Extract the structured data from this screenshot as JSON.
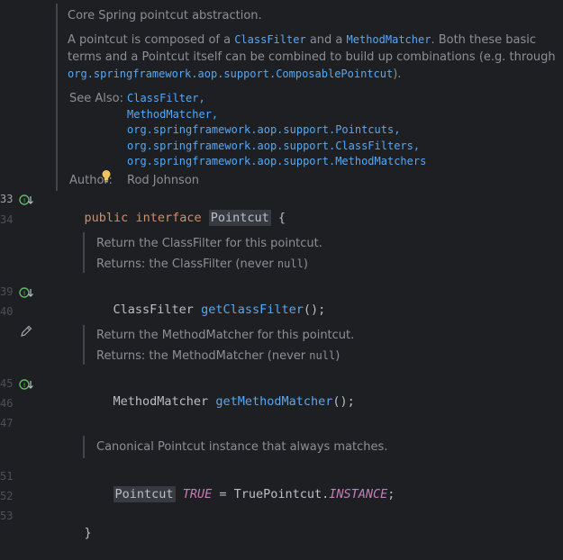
{
  "gutter": {
    "line_numbers": {
      "l33": "33",
      "l34": "34",
      "l39": "39",
      "l40": "40",
      "l45": "45",
      "l46": "46",
      "l47": "47",
      "l51": "51",
      "l52": "52",
      "l53": "53"
    }
  },
  "class_doc": {
    "summary": "Core Spring pointcut abstraction.",
    "para_1": "A pointcut is composed of a ",
    "classfilter_code": "ClassFilter",
    "para_2": " and a ",
    "methodmatcher_code": "MethodMatcher",
    "para_3": ". Both these basic terms and a Pointcut itself can be combined to build up combinations (e.g. through ",
    "composable_link": "org.springframework.aop.support.ComposablePointcut",
    "para_4": ").",
    "see_also_label": "See Also:",
    "see_also": [
      "ClassFilter,",
      "MethodMatcher,",
      "org.springframework.aop.support.Pointcuts,",
      "org.springframework.aop.support.ClassFilters,",
      "org.springframework.aop.support.MethodMatchers"
    ],
    "author_label": "Author:",
    "author_value": "Rod Johnson"
  },
  "code": {
    "public": "public",
    "interface": "interface",
    "pointcut_name": "Pointcut",
    "open_brace": " {",
    "classfilter_type": "ClassFilter",
    "get_class_filter": "getClassFilter",
    "parens_semicolon": "();",
    "methodmatcher_type": "MethodMatcher",
    "get_method_matcher": "getMethodMatcher",
    "pointcut_type": "Pointcut",
    "true_const": "TRUE",
    "assign": " = TruePointcut.",
    "instance_const": "INSTANCE",
    "semicolon": ";",
    "close_brace": "}"
  },
  "method_docs": {
    "class_filter_doc": "Return the ClassFilter for this pointcut.",
    "class_filter_returns": "Returns: the ClassFilter (never ",
    "method_matcher_doc": "Return the MethodMatcher for this pointcut.",
    "method_matcher_returns": "Returns: the MethodMatcher (never ",
    "null_code": "null",
    "close_paren": ")",
    "true_doc": "Canonical Pointcut instance that always matches."
  },
  "colors": {
    "background": "#1e1f22",
    "keyword": "#cf8e6d",
    "method": "#56a8f5",
    "constant": "#c77dbb",
    "doc_text": "#8c8f94"
  }
}
